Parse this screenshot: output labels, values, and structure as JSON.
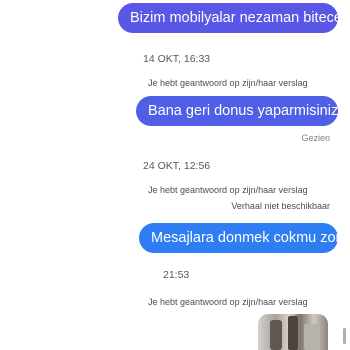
{
  "messages": [
    {
      "text": "Bizim mobilyalar nezaman bitecek?",
      "color": "#5a56e6"
    },
    {
      "text": "Bana geri donus yaparmisiniz?",
      "color": "#4f5fe6"
    },
    {
      "text": "Mesajlara donmek cokmu zor?",
      "color": "#2f7df2"
    }
  ],
  "timestamps": [
    "14 OKT, 16:33",
    "24 OKT, 12:56",
    "21:53"
  ],
  "reply_note": "Je hebt geantwoord op zijn/haar verslag",
  "seen_label": "Gezien",
  "unavailable_label": "Verhaal niet beschikbaar",
  "story_thumbnail": {
    "icon": "story-image"
  }
}
